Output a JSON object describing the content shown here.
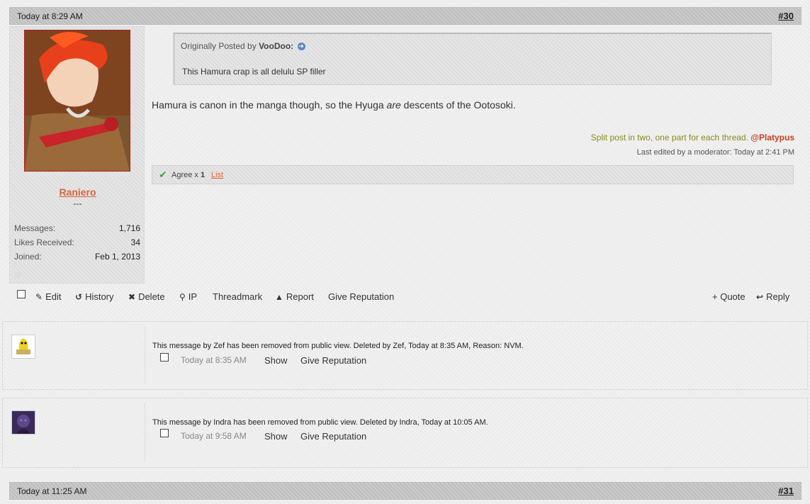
{
  "post30": {
    "date": "Today at 8:29 AM",
    "number": "#30",
    "user": {
      "name": "Raniero",
      "title": "---",
      "stats": [
        {
          "label": "Messages:",
          "value": "1,716"
        },
        {
          "label": "Likes Received:",
          "value": "34"
        },
        {
          "label": "Joined:",
          "value": "Feb 1, 2013"
        }
      ]
    },
    "quote": {
      "prefix": "Originally Posted by",
      "author": "VooDoo:",
      "text": "This Hamura crap is all delulu SP filler"
    },
    "message_before": "Hamura is canon in the manga though, so the Hyuga ",
    "message_em": "are",
    "message_after": " descents of the Ootosoki.",
    "mod_note": "Split post in two, one part for each thread.",
    "mod_mention": "@Platypus",
    "last_edited": "Last edited by a moderator: Today at 2:41 PM",
    "likes": {
      "agree": "Agree x",
      "count": "1",
      "list": "List"
    },
    "actions": {
      "edit": "Edit",
      "history": "History",
      "delete": "Delete",
      "ip": "IP",
      "threadmark": "Threadmark",
      "report": "Report",
      "give_rep": "Give Reputation",
      "quote": "+ Quote",
      "reply": "Reply"
    }
  },
  "deleted_posts": [
    {
      "text": "This message by Zef has been removed from public view. Deleted by Zef, Today at 8:35 AM, Reason: NVM.",
      "time": "Today at 8:35 AM",
      "show": "Show",
      "give_rep": "Give Reputation"
    },
    {
      "text": "This message by Indra has been removed from public view. Deleted by Indra, Today at 10:05 AM.",
      "time": "Today at 9:58 AM",
      "show": "Show",
      "give_rep": "Give Reputation"
    }
  ],
  "post31": {
    "date": "Today at 11:25 AM",
    "number": "#31"
  },
  "colors": {
    "username": "#d9643a",
    "mod_note": "#8a8a1a",
    "mention": "#c84020",
    "agree_check": "#3aa53a"
  }
}
